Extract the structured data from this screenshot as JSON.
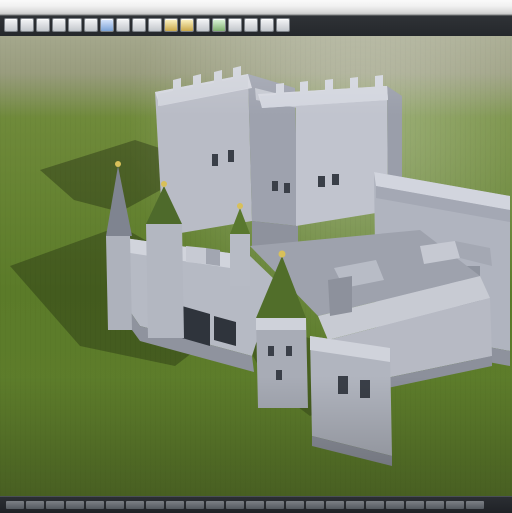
{
  "window": {
    "toolbar": {
      "buttons": [
        {
          "icon": "file-new-icon",
          "style": "normal"
        },
        {
          "icon": "folder-open-icon",
          "style": "normal"
        },
        {
          "icon": "save-icon",
          "style": "normal"
        },
        {
          "icon": "print-icon",
          "style": "normal"
        },
        {
          "icon": "undo-icon",
          "style": "normal"
        },
        {
          "icon": "redo-icon",
          "style": "normal"
        },
        {
          "icon": "select-icon",
          "style": "blue"
        },
        {
          "icon": "move-icon",
          "style": "normal"
        },
        {
          "icon": "rotate-icon",
          "style": "normal"
        },
        {
          "icon": "scale-icon",
          "style": "normal"
        },
        {
          "icon": "material-icon",
          "style": "yellow"
        },
        {
          "icon": "light-icon",
          "style": "yellow"
        },
        {
          "icon": "camera-icon",
          "style": "normal"
        },
        {
          "icon": "render-icon",
          "style": "green"
        },
        {
          "icon": "grid-icon",
          "style": "normal"
        },
        {
          "icon": "snap-icon",
          "style": "normal"
        },
        {
          "icon": "settings-icon",
          "style": "normal"
        },
        {
          "icon": "help-icon",
          "style": "normal"
        }
      ]
    },
    "viewport": {
      "scene": "castle-model"
    },
    "statusbar": {
      "segments": 24
    }
  }
}
